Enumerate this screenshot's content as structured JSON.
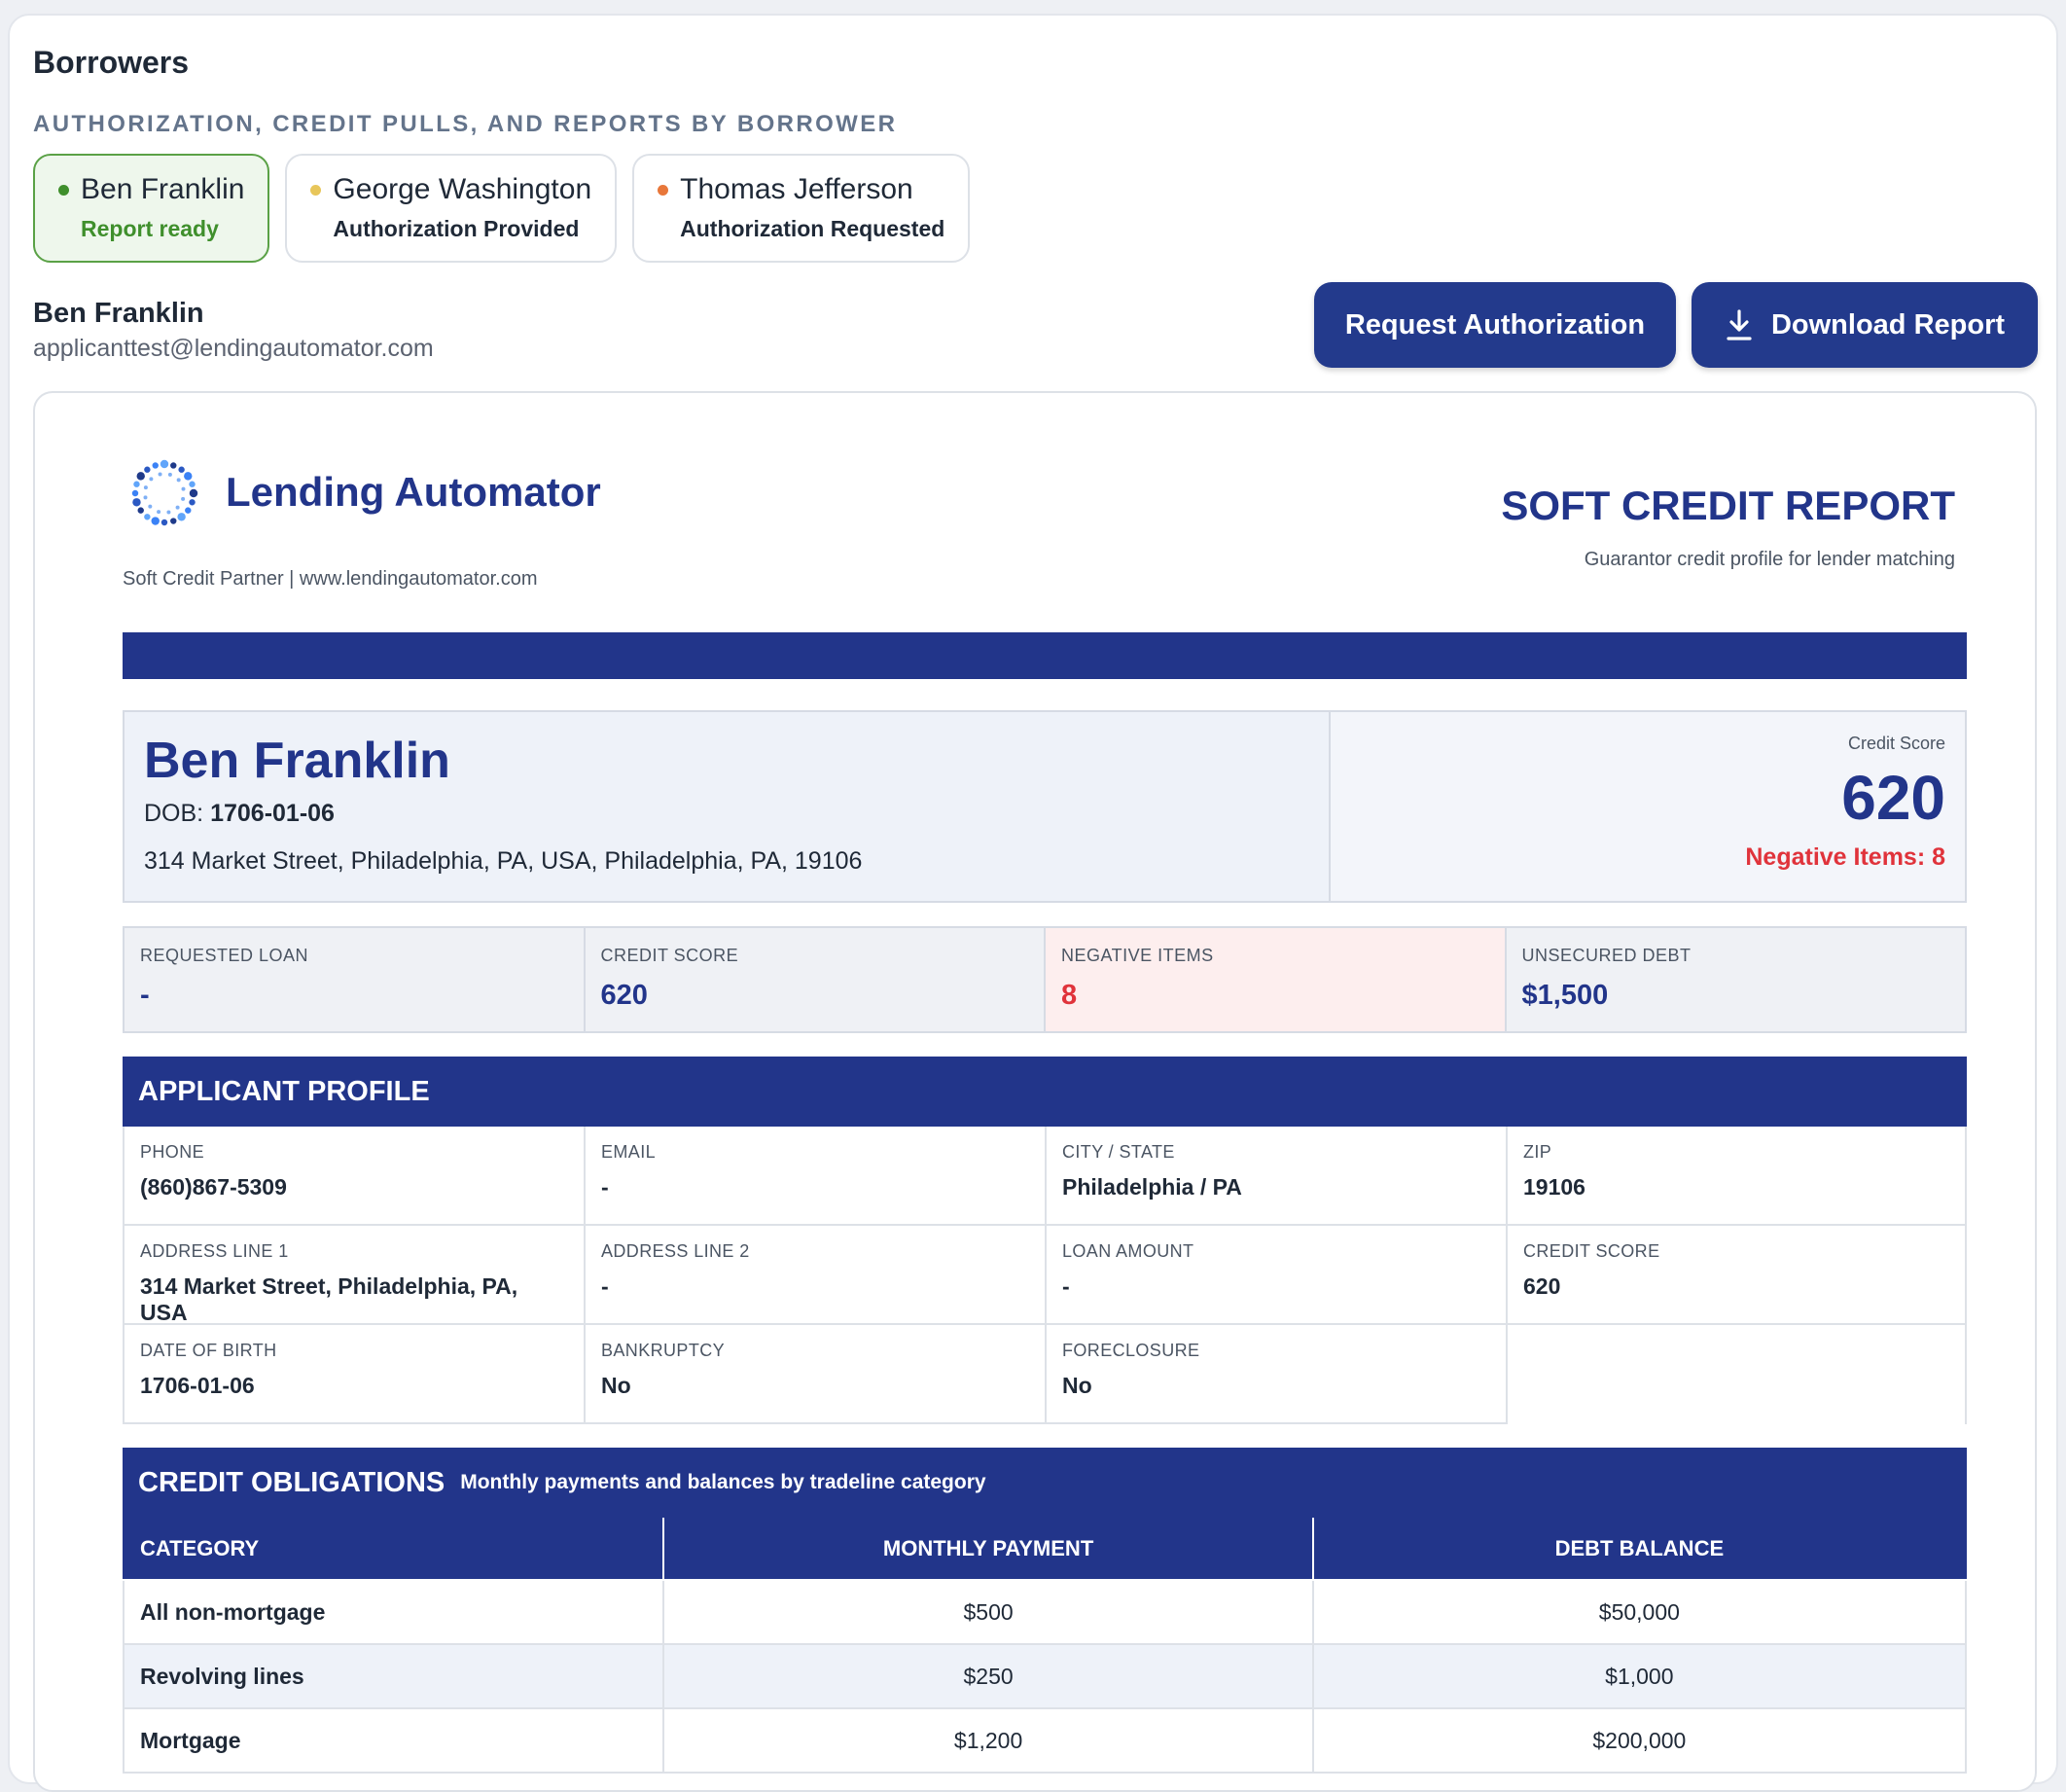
{
  "header": {
    "title": "Borrowers",
    "subtitle": "AUTHORIZATION, CREDIT PULLS, AND REPORTS BY BORROWER"
  },
  "colors": {
    "accent": "#22358a",
    "ready": "#3f8f2c",
    "provided": "#e8c65a",
    "requested": "#e8773a",
    "negative": "#e0333b"
  },
  "borrowers": [
    {
      "name": "Ben Franklin",
      "status": "Report ready"
    },
    {
      "name": "George Washington",
      "status": "Authorization Provided"
    },
    {
      "name": "Thomas Jefferson",
      "status": "Authorization Requested"
    }
  ],
  "selected": {
    "name": "Ben Franklin",
    "email": "applicanttest@lendingautomator.com"
  },
  "actions": {
    "request_label": "Request Authorization",
    "download_label": "Download Report",
    "download_icon": "download-icon"
  },
  "report": {
    "brand_name": "Lending Automator",
    "brand_tagline": "Soft Credit Partner | www.lendingautomator.com",
    "title": "SOFT CREDIT REPORT",
    "subtitle": "Guarantor credit profile for lender matching",
    "hero": {
      "name": "Ben Franklin",
      "dob_label": "DOB:",
      "dob": "1706-01-06",
      "address": "314 Market Street, Philadelphia, PA, USA, Philadelphia, PA, 19106",
      "credit_score_label": "Credit Score",
      "credit_score": "620",
      "negative_items": "Negative Items: 8"
    },
    "stats": [
      {
        "label": "REQUESTED LOAN",
        "value": "-"
      },
      {
        "label": "CREDIT SCORE",
        "value": "620"
      },
      {
        "label": "NEGATIVE ITEMS",
        "value": "8"
      },
      {
        "label": "UNSECURED DEBT",
        "value": "$1,500"
      }
    ],
    "profile": {
      "title": "APPLICANT PROFILE",
      "fields": [
        {
          "label": "PHONE",
          "value": "(860)867-5309"
        },
        {
          "label": "EMAIL",
          "value": "-"
        },
        {
          "label": "CITY / STATE",
          "value": "Philadelphia / PA"
        },
        {
          "label": "ZIP",
          "value": "19106"
        },
        {
          "label": "ADDRESS LINE 1",
          "value": "314 Market Street, Philadelphia, PA, USA"
        },
        {
          "label": "ADDRESS LINE 2",
          "value": "-"
        },
        {
          "label": "LOAN AMOUNT",
          "value": "-"
        },
        {
          "label": "CREDIT SCORE",
          "value": "620"
        },
        {
          "label": "DATE OF BIRTH",
          "value": "1706-01-06"
        },
        {
          "label": "BANKRUPTCY",
          "value": "No"
        },
        {
          "label": "FORECLOSURE",
          "value": "No"
        }
      ]
    },
    "obligations": {
      "title": "CREDIT OBLIGATIONS",
      "subtitle": "Monthly payments and balances by tradeline category",
      "columns": [
        "CATEGORY",
        "MONTHLY PAYMENT",
        "DEBT BALANCE"
      ],
      "rows": [
        [
          "All non-mortgage",
          "$500",
          "$50,000"
        ],
        [
          "Revolving lines",
          "$250",
          "$1,000"
        ],
        [
          "Mortgage",
          "$1,200",
          "$200,000"
        ]
      ]
    }
  }
}
